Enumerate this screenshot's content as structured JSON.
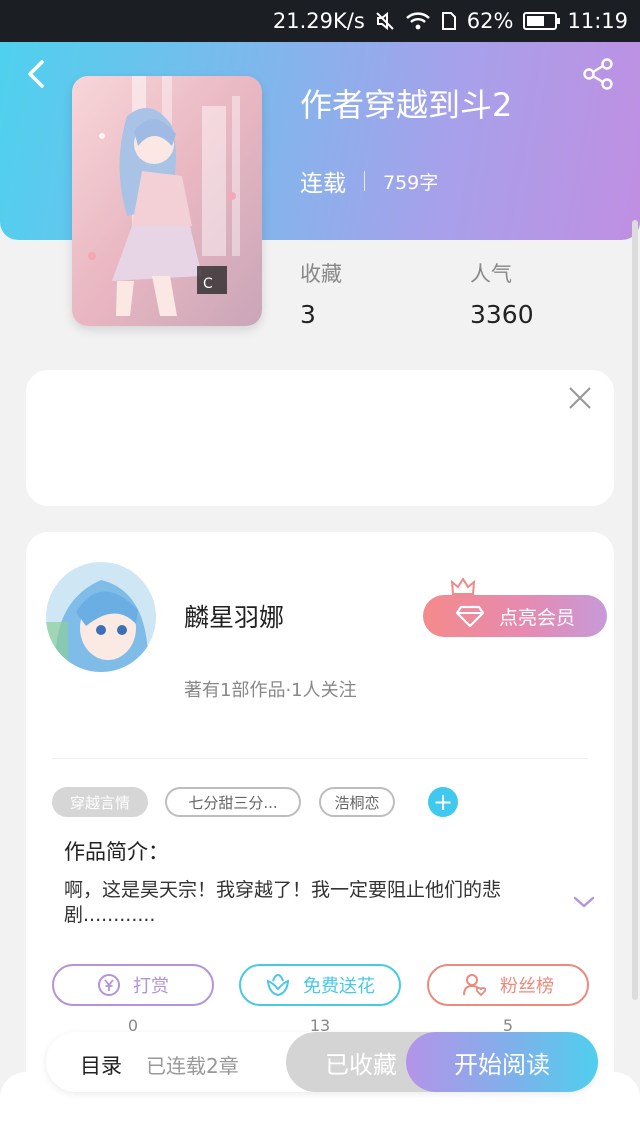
{
  "status_bar": {
    "speed": "21.29K/s",
    "battery": "62%",
    "battery_level": 0.62,
    "time": "11:19",
    "icons": [
      "mute-icon",
      "wifi-icon",
      "sim-icon",
      "battery-icon"
    ]
  },
  "book": {
    "title": "作者穿越到斗2",
    "status": "连载",
    "words": "759字",
    "stats": [
      {
        "label": "收藏",
        "value": "3"
      },
      {
        "label": "人气",
        "value": "3360"
      }
    ]
  },
  "author": {
    "name": "麟星羽娜",
    "info": "著有1部作品·1人关注",
    "vip_label": "点亮会员"
  },
  "tags": [
    "穿越言情",
    "七分甜三分...",
    "浩桐恋"
  ],
  "intro": {
    "title": "作品简介：",
    "text": "啊，这是昊天宗！我穿越了！我一定要阻止他们的悲剧............"
  },
  "actions": [
    {
      "label": "打赏",
      "count": "0",
      "color": "#b493dc"
    },
    {
      "label": "免费送花",
      "count": "13",
      "color": "#48c9e6"
    },
    {
      "label": "粉丝榜",
      "count": "5",
      "color": "#ec8a7c"
    }
  ],
  "bottom": {
    "toc_label": "目录",
    "toc_count": "已连载2章",
    "favorite_label": "已收藏",
    "read_label": "开始阅读"
  },
  "colors": {
    "accent_cyan": "#3fc9ee",
    "accent_purple": "#b493dc"
  }
}
